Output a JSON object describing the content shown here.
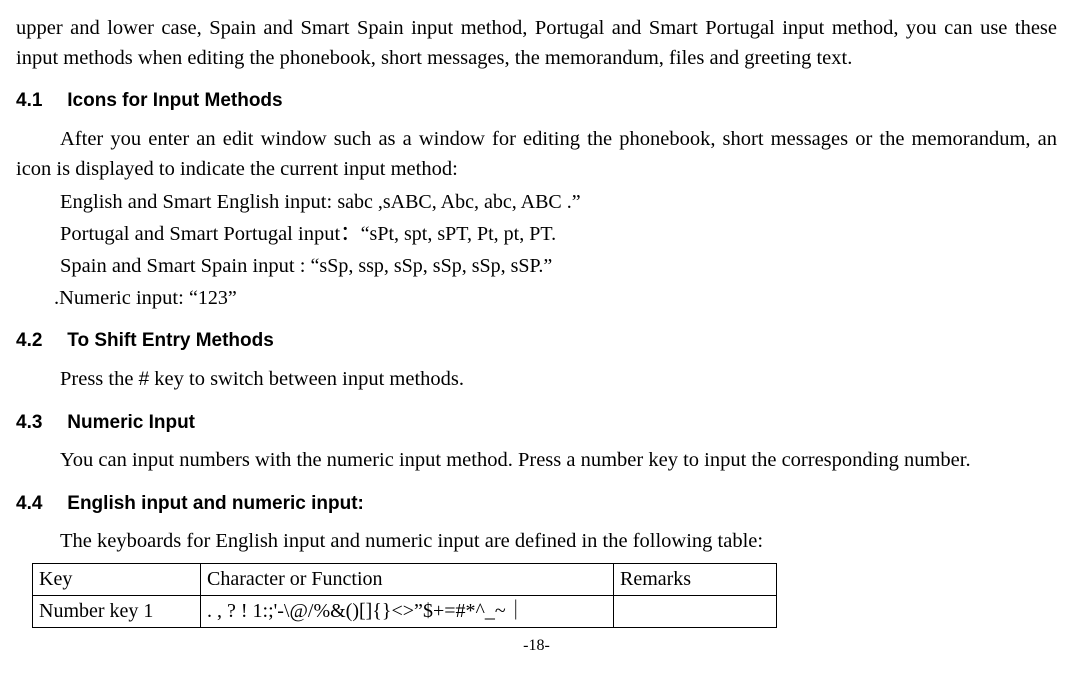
{
  "intro": "upper and lower case, Spain and Smart Spain input method, Portugal and Smart Portugal input method, you can use these input methods when editing the phonebook, short messages, the memorandum, files and greeting text.",
  "s41": {
    "num": "4.1",
    "title": "Icons for Input Methods",
    "p1": "After you enter an edit window such as a window for editing the phonebook, short messages or the memorandum, an icon is displayed to indicate the current input method:",
    "line_en_prefix": "English and Smart English input: ",
    "line_en_items": "sabc ,sABC, Abc, abc, ABC .”",
    "line_pt_prefix": "Portugal and Smart Portugal input：",
    "line_pt_items": "“sPt, spt, sPT, Pt, pt, PT.",
    "line_es_prefix": "Spain and Smart Spain input : ",
    "line_es_items": "“sSp, ssp, sSp, sSp, sSp, sSP.”",
    "line_num_prefix": ".Numeric input: ",
    "line_num_items": "“123”"
  },
  "s42": {
    "num": "4.2",
    "title": "To Shift Entry Methods",
    "p_pre": "Press the ",
    "p_hash": "#",
    "p_post": " key to switch between input methods."
  },
  "s43": {
    "num": "4.3",
    "title": "Numeric Input",
    "p1": "You can input numbers with the numeric input method. Press a number key to input the corresponding number."
  },
  "s44": {
    "num": "4.4",
    "title": "English input and numeric input:",
    "p1": "The keyboards for English input and numeric input are defined in the following table:",
    "table": {
      "header": [
        "Key",
        "Character or Function",
        "Remarks"
      ],
      "rows": [
        [
          "Number key 1",
          ". , ? ! 1:;'-\\@/%&()[]{}<>”$+=#*^_~｜",
          ""
        ]
      ]
    }
  },
  "page_number": "-18-"
}
